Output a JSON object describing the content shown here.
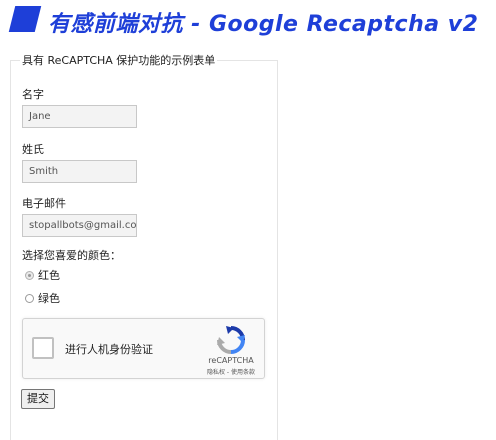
{
  "banner": {
    "title": "有感前端对抗 - Google Recaptcha v2",
    "accent_color": "#1e3fd8"
  },
  "form": {
    "legend": "具有 ReCAPTCHA 保护功能的示例表单",
    "first_name": {
      "label": "名字",
      "value": "Jane"
    },
    "last_name": {
      "label": "姓氏",
      "value": "Smith"
    },
    "email": {
      "label": "电子邮件",
      "value": "stopallbots@gmail.cor"
    },
    "color_question": "选择您喜爱的颜色：",
    "color_options": [
      {
        "label": "红色",
        "checked": true
      },
      {
        "label": "绿色",
        "checked": false
      }
    ],
    "recaptcha": {
      "checkbox_label": "进行人机身份验证",
      "brand": "reCAPTCHA",
      "terms": "隐私权 - 使用条款",
      "icon": "recaptcha-logo-icon"
    },
    "submit_label": "提交"
  }
}
